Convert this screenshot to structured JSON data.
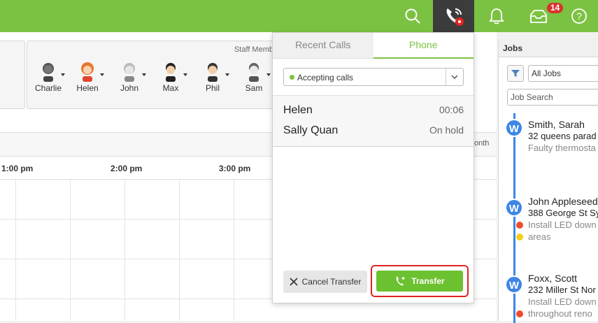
{
  "topbar": {
    "icons": [
      "search-icon",
      "phone-call-icon",
      "bell-icon",
      "inbox-icon",
      "help-icon"
    ],
    "inbox_badge": "14",
    "help_glyph": "?"
  },
  "scheduler": {
    "staff_header": "Staff Memb",
    "staff": [
      {
        "name": "Charlie"
      },
      {
        "name": "Helen"
      },
      {
        "name": "John"
      },
      {
        "name": "Max"
      },
      {
        "name": "Phil"
      },
      {
        "name": "Sam"
      }
    ],
    "month_label": "onth",
    "times": [
      "1:00 pm",
      "2:00 pm",
      "3:00 pm"
    ]
  },
  "phone_popup": {
    "tabs": [
      {
        "label": "Recent Calls",
        "active": false
      },
      {
        "label": "Phone",
        "active": true
      }
    ],
    "status": "Accepting calls",
    "calls": [
      {
        "name": "Helen",
        "status": "00:06"
      },
      {
        "name": "Sally Quan",
        "status": "On hold"
      }
    ],
    "cancel_label": "Cancel Transfer",
    "transfer_label": "Transfer"
  },
  "jobs": {
    "title": "Jobs",
    "filter_value": "All Jobs",
    "search_placeholder": "Job Search",
    "items": [
      {
        "badge": "W",
        "name": "Smith, Sarah",
        "address": "32 queens parad",
        "desc": [
          "Faulty thermosta"
        ]
      },
      {
        "badge": "W",
        "name": "John Appleseed",
        "address": "388 George St Sy",
        "desc": [
          "Install LED down",
          "areas"
        ]
      },
      {
        "badge": "W",
        "name": "Foxx, Scott",
        "address": "232 Miller St Nor",
        "desc": [
          "Install LED down",
          "throughout reno"
        ]
      }
    ]
  },
  "colors": {
    "brand_green": "#7cc242",
    "accent_blue": "#3d86e6",
    "alert_red": "#e0231f",
    "badge_red": "#d9322c"
  }
}
